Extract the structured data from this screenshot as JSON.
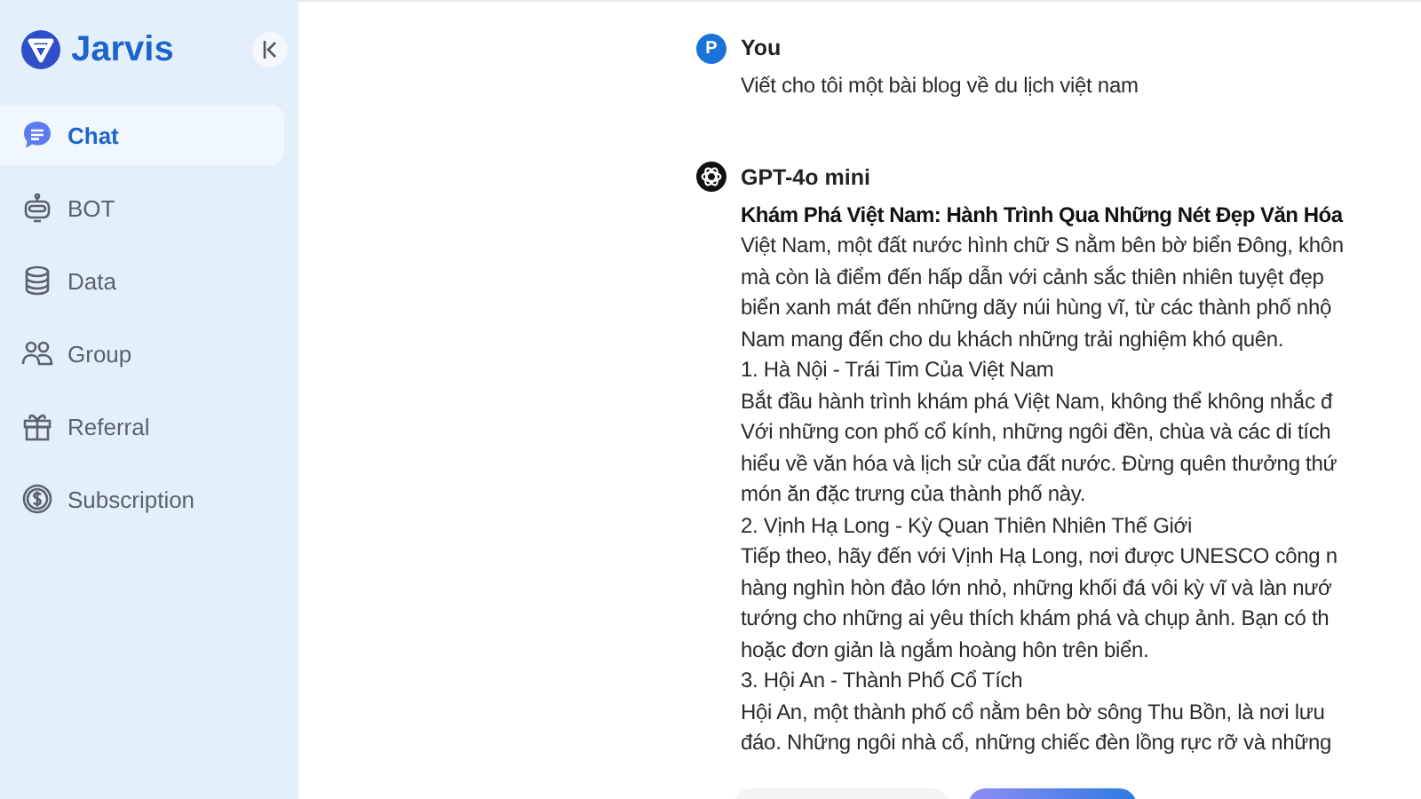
{
  "brand": {
    "name": "Jarvis"
  },
  "sidebar": {
    "items": [
      {
        "label": "Chat",
        "kind": "chat",
        "selected": true
      },
      {
        "label": "BOT",
        "kind": "bot",
        "selected": false
      },
      {
        "label": "Data",
        "kind": "data",
        "selected": false
      },
      {
        "label": "Group",
        "kind": "group",
        "selected": false
      },
      {
        "label": "Referral",
        "kind": "referral",
        "selected": false
      },
      {
        "label": "Subscription",
        "kind": "subscription",
        "selected": false
      }
    ]
  },
  "messages": [
    {
      "kind": "user",
      "avatar": "P",
      "author": "You",
      "lines": [
        {
          "text": "Viết cho tôi một bài blog về du lịch việt nam",
          "bold": false
        }
      ]
    },
    {
      "kind": "bot",
      "author": "GPT-4o mini",
      "lines": [
        {
          "text": "Khám Phá Việt Nam: Hành Trình Qua Những Nét Đẹp Văn Hóa",
          "bold": true
        },
        {
          "text": "Việt Nam, một đất nước hình chữ S nằm bên bờ biển Đông, khôn",
          "bold": false
        },
        {
          "text": "mà còn là điểm đến hấp dẫn với cảnh sắc thiên nhiên tuyệt đẹp",
          "bold": false
        },
        {
          "text": "biển xanh mát đến những dãy núi hùng vĩ, từ các thành phố nhộ",
          "bold": false
        },
        {
          "text": "Nam mang đến cho du khách những trải nghiệm khó quên.",
          "bold": false
        },
        {
          "text": "1. Hà Nội - Trái Tim Của Việt Nam",
          "bold": false
        },
        {
          "text": "Bắt đầu hành trình khám phá Việt Nam, không thể không nhắc đ",
          "bold": false
        },
        {
          "text": "Với những con phố cổ kính, những ngôi đền, chùa và các di tích",
          "bold": false
        },
        {
          "text": "hiểu về văn hóa và lịch sử của đất nước. Đừng quên thưởng thứ",
          "bold": false
        },
        {
          "text": "món ăn đặc trưng của thành phố này.",
          "bold": false
        },
        {
          "text": "2. Vịnh Hạ Long - Kỳ Quan Thiên Nhiên Thế Giới",
          "bold": false
        },
        {
          "text": "Tiếp theo, hãy đến với Vịnh Hạ Long, nơi được UNESCO công n",
          "bold": false
        },
        {
          "text": "hàng nghìn hòn đảo lớn nhỏ, những khối đá vôi kỳ vĩ và làn nướ",
          "bold": false
        },
        {
          "text": "tướng cho những ai yêu thích khám phá và chụp ảnh. Bạn có th",
          "bold": false
        },
        {
          "text": "hoặc đơn giản là ngắm hoàng hôn trên biển.",
          "bold": false
        },
        {
          "text": "3. Hội An - Thành Phố Cổ Tích",
          "bold": false
        },
        {
          "text": "Hội An, một thành phố cổ nằm bên bờ sông Thu Bồn, là nơi lưu",
          "bold": false
        },
        {
          "text": "đáo. Những ngôi nhà cổ, những chiếc đèn lồng rực rỡ và những",
          "bold": false
        }
      ]
    }
  ]
}
